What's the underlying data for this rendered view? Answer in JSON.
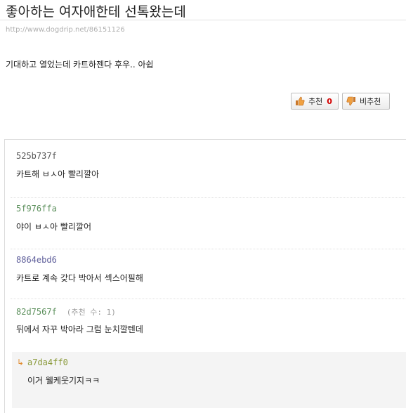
{
  "post": {
    "title": "좋아하는 여자애한테 선톡왔는데",
    "url": "http://www.dogdrip.net/86151126",
    "body": "기대하고 열었는데 카트하젠다 후우.. 아쉽"
  },
  "votes": {
    "up_label": "추천",
    "up_count": "0",
    "down_label": "비추천"
  },
  "comments": [
    {
      "author": "525b737f",
      "author_color": "#555555",
      "text": "카트해 ㅂㅅ아 빨리깔아"
    },
    {
      "author": "5f976ffa",
      "author_color": "#5b8f5b",
      "text": "야이 ㅂㅅ아 빨리깔어"
    },
    {
      "author": "8864ebd6",
      "author_color": "#5e5e9a",
      "text": "카트로 계속 갖다 박아서 섹스어필해"
    },
    {
      "author": "82d7567f",
      "author_color": "#5b8f5b",
      "note": "(추천 수: 1)",
      "text": "뒤에서 자꾸 박아라 그럼 눈치깔텐데"
    }
  ],
  "reply": {
    "author": "a7da4ff0",
    "author_color": "#8a9a3a",
    "text": "이거 웰케웃기지ㅋㅋ"
  }
}
